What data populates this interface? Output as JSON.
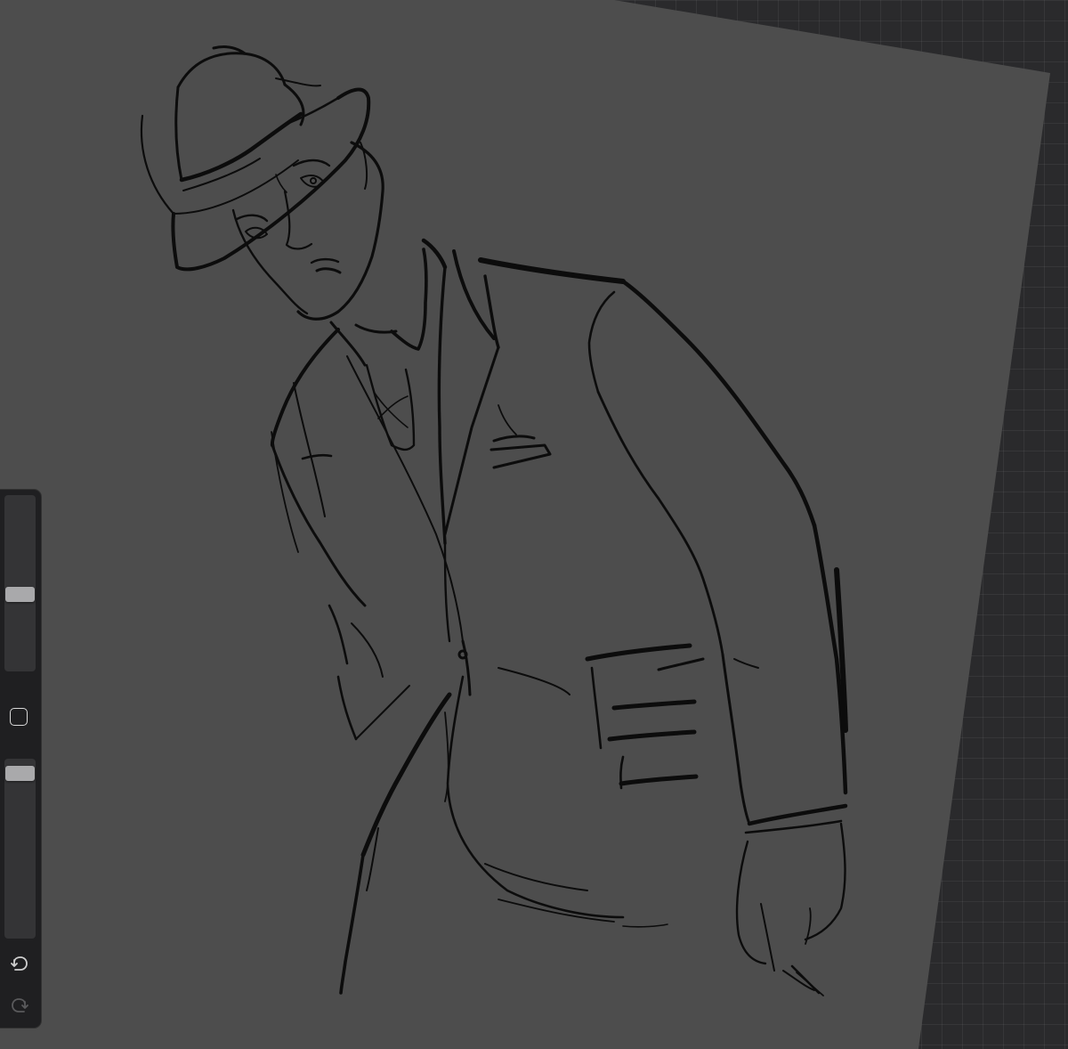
{
  "app": {
    "background_color": "#2a2a2c",
    "canvas_color": "#4d4d4d",
    "ink_color": "#0c0c0c",
    "sidebar_color": "#1f1f21"
  },
  "sidebar": {
    "brush_size_slider": {
      "value": 0.57
    },
    "modify_button": {
      "icon": "square-outline-icon"
    },
    "brush_opacity_slider": {
      "value": 0.04
    },
    "undo_button": {
      "icon": "undo-arrow-icon",
      "enabled": true
    },
    "redo_button": {
      "icon": "redo-arrow-icon",
      "enabled": false
    }
  },
  "artwork": {
    "subject": "sketch-of-man-in-fedora-and-suit"
  }
}
